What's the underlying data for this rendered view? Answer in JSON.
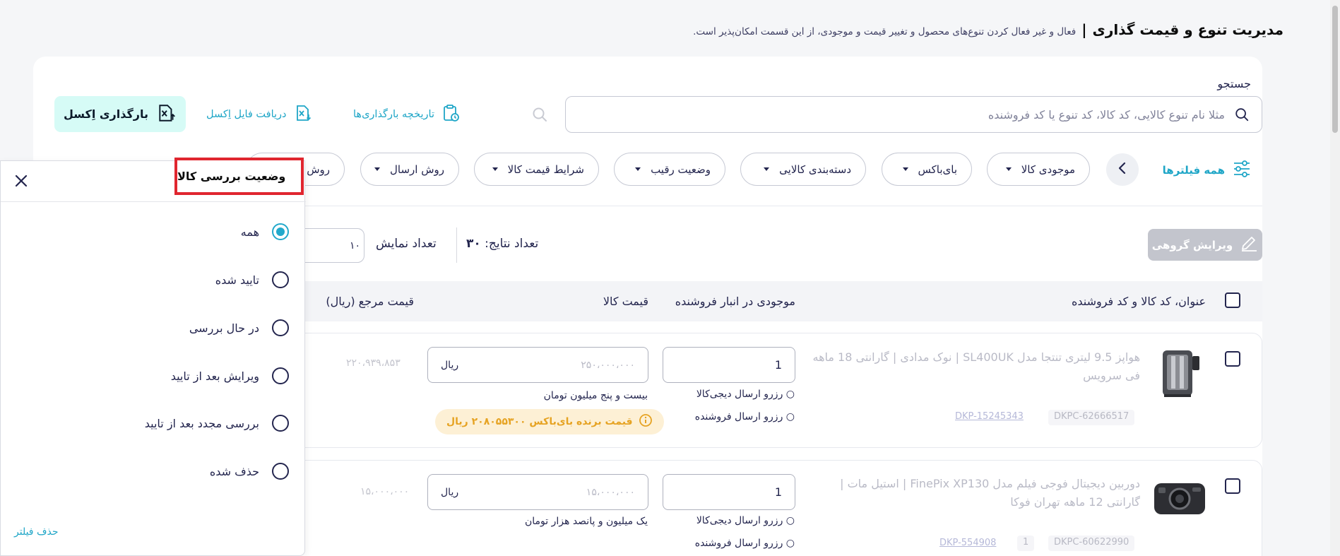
{
  "header": {
    "title": "مدیریت تنوع و قیمت گذاری",
    "separator": "|",
    "description": "فعال و غیر فعال کردن تنوع‌های محصول و تغییر قیمت و موجودی، از این قسمت امکان‌پذیر است."
  },
  "search": {
    "label": "جستجو",
    "placeholder": "مثلا نام تنوع کالایی، کد کالا، کد تنوع یا کد فروشنده"
  },
  "toolbar": {
    "history_label": "تاریخچه بارگذاری‌ها",
    "excel_download_label": "دریافت فایل اِکسل",
    "excel_upload_label": "بارگذاری اِکسل"
  },
  "filters": {
    "all_label": "همه فیلترها",
    "chips": [
      "موجودی کالا",
      "بای‌باکس",
      "دسته‌بندی کالایی",
      "وضعیت رقیب",
      "شرایط قیمت کالا",
      "روش ارسال",
      "روش"
    ]
  },
  "results": {
    "bulk_edit_label": "ویرایش گروهی",
    "count_label": "تعداد نتایج:",
    "count_value": "۳۰",
    "per_page_label": "تعداد نمایش",
    "per_page_value": "۱۰"
  },
  "table": {
    "headers": {
      "title": "عنوان، کد کالا و کد فروشنده",
      "stock": "موجودی در انبار فروشنده",
      "price": "قیمت کالا",
      "ref_price": "قیمت مرجع (ریال)"
    },
    "rows": [
      {
        "title": "هواپز 9.5 لیتری تنتجا مدل SL400UK | نوک مدادی | گارانتی 18 ماهه فی سرویس",
        "dkpc": "DKPC-62666517",
        "dkp": "DKP-15245343",
        "dkp_count": "",
        "stock": "1",
        "reserve_digikala": "رزرو ارسال دیجی‌کالا",
        "reserve_seller": "رزرو ارسال فروشنده",
        "price_value": "۲۵۰،۰۰۰،۰۰۰",
        "price_unit": "ریال",
        "price_words": "بیست و پنج میلیون تومان",
        "buybox": "قیمت برنده بای‌باکس ۲۰۸۰۵۵۳۰۰ ریال",
        "ref_price": "۲۲۰،۹۳۹،۸۵۳"
      },
      {
        "title": "دوربین دیجیتال فوجی فیلم مدل FinePix XP130 | استیل مات | گارانتی 12 ماهه تهران فوکا",
        "dkpc": "DKPC-60622990",
        "dkp": "DKP-554908",
        "dkp_count": "1",
        "stock": "1",
        "reserve_digikala": "رزرو ارسال دیجی‌کالا",
        "reserve_seller": "رزرو ارسال فروشنده",
        "price_value": "۱۵،۰۰۰،۰۰۰",
        "price_unit": "ریال",
        "price_words": "یک میلیون و پانصد هزار تومان",
        "buybox": "",
        "ref_price": "۱۵،۰۰۰،۰۰۰"
      }
    ]
  },
  "panel": {
    "title": "وضعیت بررسی کالا",
    "options": [
      {
        "label": "همه",
        "selected": true
      },
      {
        "label": "تایید شده",
        "selected": false
      },
      {
        "label": "در حال بررسی",
        "selected": false
      },
      {
        "label": "ویرایش بعد از تایید",
        "selected": false
      },
      {
        "label": "بررسی مجدد بعد از تایید",
        "selected": false
      },
      {
        "label": "حذف شده",
        "selected": false
      }
    ],
    "remove_filter_label": "حذف فیلتر"
  },
  "colors": {
    "accent": "#1fa6c7",
    "highlight_border": "#e0262f",
    "upload_bg": "#d6fbf6",
    "buybox_bg": "#fdf0d5",
    "buybox_text": "#e6a323"
  },
  "icons": {
    "search": "search-icon",
    "history": "clipboard-history-icon",
    "excel_download": "excel-download-icon",
    "excel_upload": "excel-upload-icon",
    "filters": "sliders-icon",
    "scroll": "chevron-left-icon",
    "edit": "pencil-icon",
    "info": "info-icon",
    "close": "close-icon"
  }
}
